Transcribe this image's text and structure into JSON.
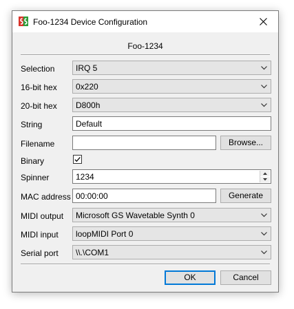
{
  "window": {
    "title": "Foo-1234 Device Configuration",
    "icon": "app-logo-icon",
    "close_icon": "close-icon"
  },
  "device_heading": "Foo-1234",
  "fields": {
    "selection": {
      "label": "Selection",
      "value": "IRQ 5"
    },
    "hex16": {
      "label": "16-bit hex",
      "value": "0x220"
    },
    "hex20": {
      "label": "20-bit hex",
      "value": "D800h"
    },
    "string": {
      "label": "String",
      "value": "Default"
    },
    "filename": {
      "label": "Filename",
      "value": "",
      "browse_label": "Browse..."
    },
    "binary": {
      "label": "Binary",
      "checked": true
    },
    "spinner": {
      "label": "Spinner",
      "value": "1234"
    },
    "mac": {
      "label": "MAC address",
      "value": "00:00:00",
      "generate_label": "Generate"
    },
    "midi_output": {
      "label": "MIDI output",
      "value": "Microsoft GS Wavetable Synth 0"
    },
    "midi_input": {
      "label": "MIDI input",
      "value": "loopMIDI Port 0"
    },
    "serial_port": {
      "label": "Serial port",
      "value": "\\\\.\\COM1"
    }
  },
  "buttons": {
    "ok_label": "OK",
    "cancel_label": "Cancel"
  },
  "colors": {
    "dialog_bg": "#f0f0f0",
    "accent": "#0078d7",
    "icon_red": "#d9342b",
    "icon_green": "#2e9d3a"
  }
}
